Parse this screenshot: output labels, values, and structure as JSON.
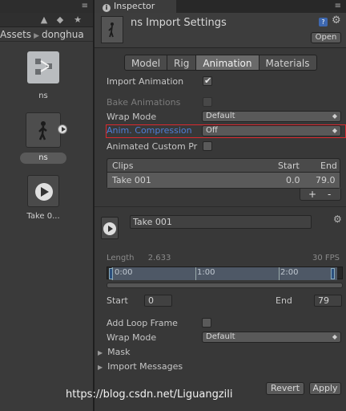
{
  "project": {
    "menu_icon": "≡",
    "toolbar_icons": [
      "filter-by-type-icon",
      "label-icon",
      "favorite-star-icon"
    ],
    "breadcrumb": [
      "Assets",
      "donghua"
    ],
    "assets": [
      {
        "name": "ns",
        "icon": "model-prefab-icon"
      },
      {
        "name": "ns",
        "icon": "character-thumbnail",
        "selected": true
      },
      {
        "name": "Take 0...",
        "icon": "animation-clip-play-icon"
      }
    ]
  },
  "inspector": {
    "tab_label": "Inspector",
    "menu_icon": "≡",
    "title": "ns Import Settings",
    "open_label": "Open",
    "tabs": [
      "Model",
      "Rig",
      "Animation",
      "Materials"
    ],
    "active_tab": "Animation",
    "fields": {
      "import_animation": {
        "label": "Import Animation",
        "checked": true
      },
      "bake_animations": {
        "label": "Bake Animations",
        "checked": false
      },
      "wrap_mode": {
        "label": "Wrap Mode",
        "value": "Default"
      },
      "anim_compression": {
        "label": "Anim. Compression",
        "value": "Off"
      },
      "animated_custom": {
        "label": "Animated Custom Pr",
        "checked": false
      }
    },
    "clips": {
      "header": {
        "name": "Clips",
        "start": "Start",
        "end": "End"
      },
      "rows": [
        {
          "name": "Take 001",
          "start": "0.0",
          "end": "79.0"
        }
      ],
      "add_label": "+",
      "remove_label": "-"
    },
    "clip_detail": {
      "name": "Take 001",
      "length_label": "Length",
      "length_value": "2.633",
      "fps_label": "30 FPS",
      "timeline_marks": [
        "0:00",
        "1:00",
        "2:00"
      ],
      "start_label": "Start",
      "start_value": "0",
      "end_label": "End",
      "end_value": "79",
      "add_loop_frame": {
        "label": "Add Loop Frame",
        "checked": false
      },
      "wrap_mode": {
        "label": "Wrap Mode",
        "value": "Default"
      }
    },
    "foldouts": [
      "Mask",
      "Import Messages"
    ],
    "buttons": {
      "revert": "Revert",
      "apply": "Apply"
    }
  },
  "watermark": "https://blog.csdn.net/Liguangzili",
  "colors": {
    "highlight_border": "#d9292f",
    "highlight_label": "#4f7fd8"
  }
}
